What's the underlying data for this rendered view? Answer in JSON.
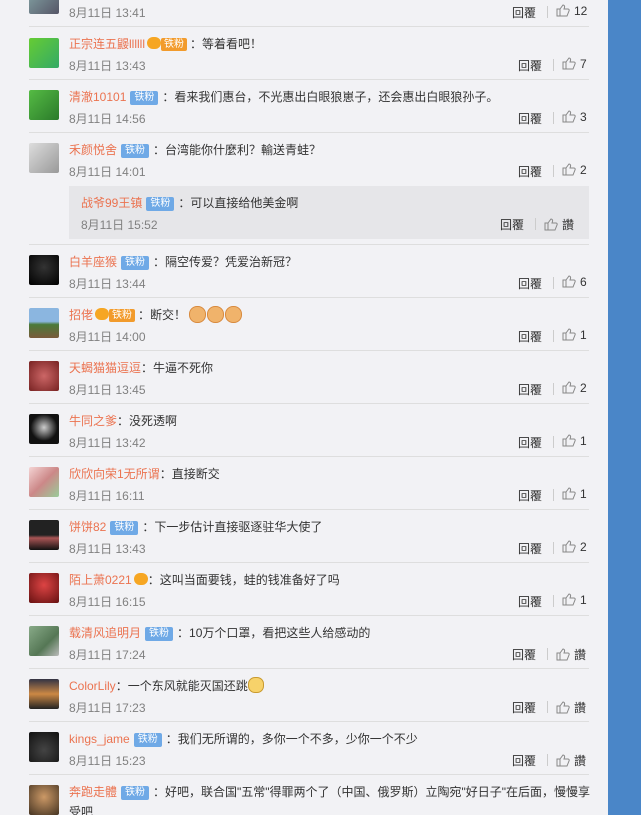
{
  "ui": {
    "reply_label": "回覆",
    "zan_label": "讚",
    "fan_badge": "铁粉",
    "vip_badge": "铁粉"
  },
  "comments": [
    {
      "name": "",
      "text": "",
      "time": "8月11日 13:41",
      "likes": "12"
    },
    {
      "name": "正宗连五鼹llllll",
      "text": "：等着看吧！",
      "time": "8月11日 13:43",
      "likes": "7"
    },
    {
      "name": "清澈10101",
      "text": "：看来我们惠台，不光惠出白眼狼崽子，还会惠出白眼狼孙子。",
      "time": "8月11日 14:56",
      "likes": "3"
    },
    {
      "name": "禾颜悦舍",
      "text": "：台湾能你什麼利？輸送青蛙？",
      "time": "8月11日 14:01",
      "likes": "2"
    },
    {
      "name": "白羊座猴",
      "text": "：隔空传爱？凭爱治新冠？",
      "time": "8月11日 13:44",
      "likes": "6"
    },
    {
      "name": "招佬",
      "text": "：断交！",
      "time": "8月11日 14:00",
      "likes": "1"
    },
    {
      "name": "天蝎猫猫逗逗",
      "text": "：牛逼不死你",
      "time": "8月11日 13:45",
      "likes": "2"
    },
    {
      "name": "牛同之爹",
      "text": "：没死透啊",
      "time": "8月11日 13:42",
      "likes": "1"
    },
    {
      "name": "欣欣向荣1无所谓",
      "text": "：直接断交",
      "time": "8月11日 16:11",
      "likes": "1"
    },
    {
      "name": "饼饼82",
      "text": "：下一步估计直接驱逐驻华大使了",
      "time": "8月11日 13:43",
      "likes": "2"
    },
    {
      "name": "陌上萧0221",
      "text": "：这叫当面要钱，蛙的钱准备好了吗",
      "time": "8月11日 16:15",
      "likes": "1"
    },
    {
      "name": "载清风追明月",
      "text": "：10万个口罩，看把这些人给感动的",
      "time": "8月11日 17:24",
      "likes": ""
    },
    {
      "name": "ColorLily",
      "text": "：一个东风就能灭国还跳",
      "time": "8月11日 17:23",
      "likes": ""
    },
    {
      "name": "kings_jame",
      "text": "：我们无所谓的，多你一个不多，少你一个不少",
      "time": "8月11日 15:23",
      "likes": ""
    },
    {
      "name": "奔跑走體",
      "text": "：好吧，联合国\"五常\"得罪两个了（中国、俄罗斯）立陶宛\"好日子\"在后面，慢慢享",
      "text2": "受吧"
    }
  ],
  "subreply": {
    "name": "战爷99王镇",
    "text": "：可以直接给他美金啊",
    "time": "8月11日 15:52"
  }
}
